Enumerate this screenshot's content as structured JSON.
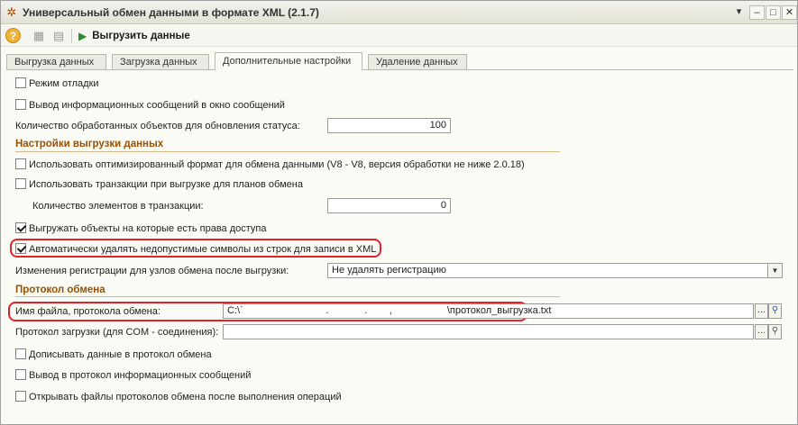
{
  "window": {
    "title": "Универсальный обмен данными в формате XML (2.1.7)",
    "app_icon": "1c-star-icon",
    "controls": {
      "menu": "▾",
      "minimize": "–",
      "maximize": "□",
      "close": "✕"
    }
  },
  "toolbar": {
    "help_label": "?",
    "run_label": "Выгрузить данные"
  },
  "tabs": [
    {
      "label": "Выгрузка данных",
      "active": false
    },
    {
      "label": "Загрузка данных",
      "active": false
    },
    {
      "label": "Дополнительные настройки",
      "active": true
    },
    {
      "label": "Удаление данных",
      "active": false
    }
  ],
  "settings": {
    "debug_mode": {
      "label": "Режим отладки",
      "checked": false
    },
    "info_messages": {
      "label": "Вывод информационных сообщений в окно сообщений",
      "checked": false
    },
    "processed_count": {
      "label": "Количество обработанных объектов для обновления статуса:",
      "value": "100"
    }
  },
  "export_settings": {
    "header": "Настройки выгрузки данных",
    "optimized_format": {
      "label": "Использовать оптимизированный формат для обмена данными (V8 - V8, версия обработки не ниже 2.0.18)",
      "checked": false
    },
    "use_transactions": {
      "label": "Использовать транзакции при выгрузке для планов обмена",
      "checked": false
    },
    "tx_count": {
      "label": "Количество элементов в транзакции:",
      "value": "0"
    },
    "access_rights": {
      "label": "Выгружать объекты на которые есть права доступа",
      "checked": true
    },
    "remove_invalid": {
      "label": "Автоматически удалять недопустимые символы из строк для записи в XML",
      "checked": true
    },
    "registration": {
      "label": "Изменения регистрации для узлов обмена после выгрузки:",
      "value": "Не удалять регистрацию"
    }
  },
  "protocol": {
    "header": "Протокол обмена",
    "file_name": {
      "label": "Имя файла, протокола обмена:",
      "value": "C:\\`                              .             .        ,                    \\протокол_выгрузка.txt"
    },
    "load_protocol": {
      "label": "Протокол загрузки (для COM - соединения):",
      "value": ""
    },
    "append": {
      "label": "Дописывать данные в протокол обмена",
      "checked": false
    },
    "info_to_protocol": {
      "label": "Вывод в протокол информационных сообщений",
      "checked": false
    },
    "open_after": {
      "label": "Открывать файлы протоколов обмена после выполнения операций",
      "checked": false
    }
  },
  "colors": {
    "section_header": "#9a4f00",
    "highlight": "#e0232b",
    "run_icon": "#2a8a2a"
  }
}
